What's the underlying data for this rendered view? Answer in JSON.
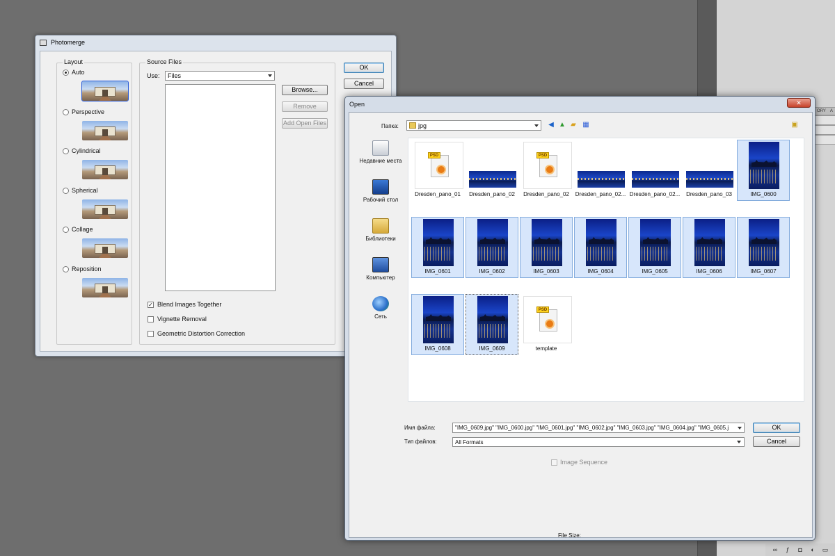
{
  "app_panel": {
    "tabs": [
      "ORY",
      "A"
    ],
    "bottom_icons": [
      "link-icon",
      "fx-icon",
      "mask-icon",
      "adjust-icon",
      "folder-icon"
    ]
  },
  "photomerge": {
    "title": "Photomerge",
    "layout_legend": "Layout",
    "layout_options": [
      {
        "label": "Auto",
        "selected": true
      },
      {
        "label": "Perspective",
        "selected": false
      },
      {
        "label": "Cylindrical",
        "selected": false
      },
      {
        "label": "Spherical",
        "selected": false
      },
      {
        "label": "Collage",
        "selected": false
      },
      {
        "label": "Reposition",
        "selected": false
      }
    ],
    "source_legend": "Source Files",
    "use_label": "Use:",
    "use_value": "Files",
    "browse_label": "Browse...",
    "remove_label": "Remove",
    "add_open_label": "Add Open Files",
    "ok_label": "OK",
    "cancel_label": "Cancel",
    "blend_label": "Blend Images Together",
    "blend_checked": true,
    "vignette_label": "Vignette Removal",
    "vignette_checked": false,
    "geom_label": "Geometric Distortion Correction",
    "geom_checked": false
  },
  "open_dialog": {
    "title": "Open",
    "close_glyph": "✕",
    "folder_label": "Папка:",
    "folder_value": "jpg",
    "places": [
      {
        "label": "Недавние места"
      },
      {
        "label": "Рабочий стол"
      },
      {
        "label": "Библиотеки"
      },
      {
        "label": "Компьютер"
      },
      {
        "label": "Сеть"
      }
    ],
    "files": [
      {
        "name": "Dresden_pano_01",
        "kind": "psd",
        "selected": false
      },
      {
        "name": "Dresden_pano_02",
        "kind": "pano",
        "selected": false
      },
      {
        "name": "Dresden_pano_02",
        "kind": "psd",
        "selected": false
      },
      {
        "name": "Dresden_pano_02...",
        "kind": "pano",
        "selected": false
      },
      {
        "name": "Dresden_pano_02...",
        "kind": "pano",
        "selected": false
      },
      {
        "name": "Dresden_pano_03",
        "kind": "pano",
        "selected": false
      },
      {
        "name": "IMG_0600",
        "kind": "night",
        "selected": true
      },
      {
        "name": "IMG_0601",
        "kind": "night",
        "selected": true
      },
      {
        "name": "IMG_0602",
        "kind": "night",
        "selected": true
      },
      {
        "name": "IMG_0603",
        "kind": "night",
        "selected": true
      },
      {
        "name": "IMG_0604",
        "kind": "night",
        "selected": true
      },
      {
        "name": "IMG_0605",
        "kind": "night",
        "selected": true
      },
      {
        "name": "IMG_0606",
        "kind": "night",
        "selected": true
      },
      {
        "name": "IMG_0607",
        "kind": "night",
        "selected": true
      },
      {
        "name": "IMG_0608",
        "kind": "night",
        "selected": true
      },
      {
        "name": "IMG_0609",
        "kind": "night",
        "selected": true
      },
      {
        "name": "template",
        "kind": "psd",
        "selected": false
      }
    ],
    "filename_label": "Имя файла:",
    "filename_value": "\"IMG_0609.jpg\" \"IMG_0600.jpg\" \"IMG_0601.jpg\" \"IMG_0602.jpg\" \"IMG_0603.jpg\" \"IMG_0604.jpg\" \"IMG_0605.j",
    "filetype_label": "Тип файлов:",
    "filetype_value": "All Formats",
    "ok_label": "OK",
    "cancel_label": "Cancel",
    "sequence_label": "Image Sequence",
    "filesize_label": "File Size:"
  },
  "colors": {
    "selection_fill": "#d7e6fb",
    "selection_border": "#84acdd",
    "desktop": "#6e6e6e"
  }
}
